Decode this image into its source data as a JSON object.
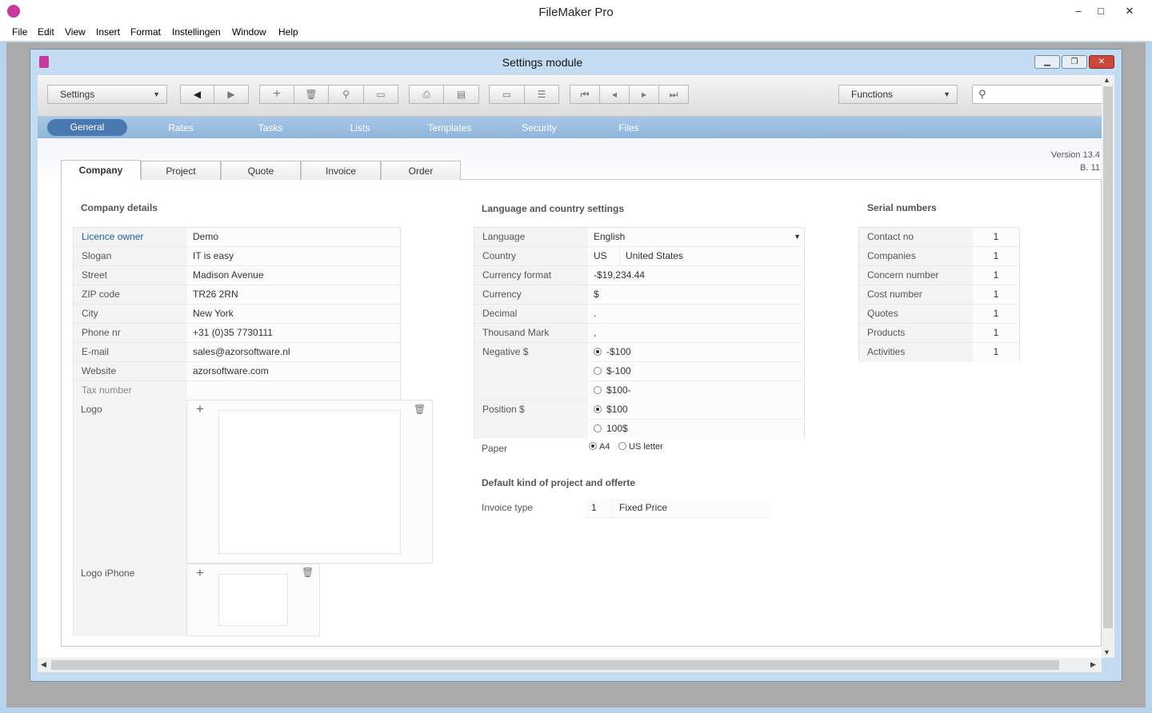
{
  "app": {
    "title": "FileMaker Pro"
  },
  "menu": [
    "File",
    "Edit",
    "View",
    "Insert",
    "Format",
    "Instellingen",
    "Window",
    "Help"
  ],
  "window": {
    "title": "Settings module"
  },
  "toolbar": {
    "layout_select": "Settings",
    "functions_select": "Functions",
    "search_placeholder": ""
  },
  "nav": {
    "items": [
      "General",
      "Rates",
      "Tasks",
      "Lists",
      "Templates",
      "Security",
      "Files"
    ],
    "active": "General"
  },
  "version": {
    "line1": "Version 13.4",
    "line2": "B. 11"
  },
  "tabs": [
    "Company",
    "Project",
    "Quote",
    "Invoice",
    "Order"
  ],
  "company": {
    "heading": "Company details",
    "fields": [
      {
        "label": "Licence owner",
        "value": "Demo"
      },
      {
        "label": "Slogan",
        "value": "IT is easy"
      },
      {
        "label": "Street",
        "value": "Madison Avenue"
      },
      {
        "label": "ZIP code",
        "value": "TR26 2RN"
      },
      {
        "label": "City",
        "value": "New York"
      },
      {
        "label": "Phone nr",
        "value": "+31 (0)35 7730111"
      },
      {
        "label": "E-mail",
        "value": "sales@azorsoftware.nl"
      },
      {
        "label": "Website",
        "value": "azorsoftware.com"
      },
      {
        "label": "Tax number",
        "value": ""
      }
    ],
    "logo_label": "Logo",
    "logo_iphone_label": "Logo iPhone"
  },
  "language": {
    "heading": "Language and country settings",
    "language_label": "Language",
    "language_value": "English",
    "country_label": "Country",
    "country_code": "US",
    "country_name": "United States",
    "currency_format_label": "Currency format",
    "currency_format_value": "-$19,234.44",
    "currency_label": "Currency",
    "currency_value": "$",
    "decimal_label": "Decimal",
    "decimal_value": ".",
    "thousand_label": "Thousand Mark",
    "thousand_value": ",",
    "negative_label": "Negative $",
    "negative_options": [
      "-$100",
      "$-100",
      "$100-"
    ],
    "negative_selected": "-$100",
    "position_label": "Position $",
    "position_options": [
      "$100",
      "100$"
    ],
    "position_selected": "$100",
    "paper_label": "Paper",
    "paper_options": [
      "A4",
      "US letter"
    ],
    "paper_selected": "A4"
  },
  "project_default": {
    "heading": "Default kind of project and offerte",
    "invoice_type_label": "Invoice type",
    "invoice_type_code": "1",
    "invoice_type_name": "Fixed Price"
  },
  "serials": {
    "heading": "Serial numbers",
    "items": [
      {
        "label": "Contact no",
        "value": "1"
      },
      {
        "label": "Companies",
        "value": "1"
      },
      {
        "label": "Concern number",
        "value": "1"
      },
      {
        "label": "Cost number",
        "value": "1"
      },
      {
        "label": "Quotes",
        "value": "1"
      },
      {
        "label": "Products",
        "value": "1"
      },
      {
        "label": "Activities",
        "value": "1"
      }
    ]
  }
}
